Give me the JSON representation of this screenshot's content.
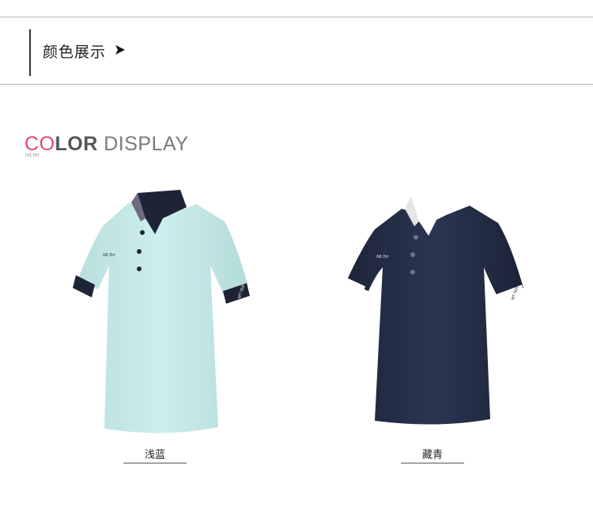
{
  "header": {
    "title": "颜色展示"
  },
  "section": {
    "heading_c": "C",
    "heading_o": "O",
    "heading_lor": "LOR",
    "heading_display": " DISPLAY",
    "sub_text": "mt.ter"
  },
  "products": [
    {
      "name": "浅蓝",
      "body_color": "#c9ebea",
      "collar_color": "#1e2336",
      "cuff_text": "MT.TER"
    },
    {
      "name": "藏青",
      "body_color": "#26304a",
      "collar_color": "#ffffff",
      "cuff_text": "MT.TER"
    }
  ],
  "colors": {
    "accent": "#e0486b"
  }
}
